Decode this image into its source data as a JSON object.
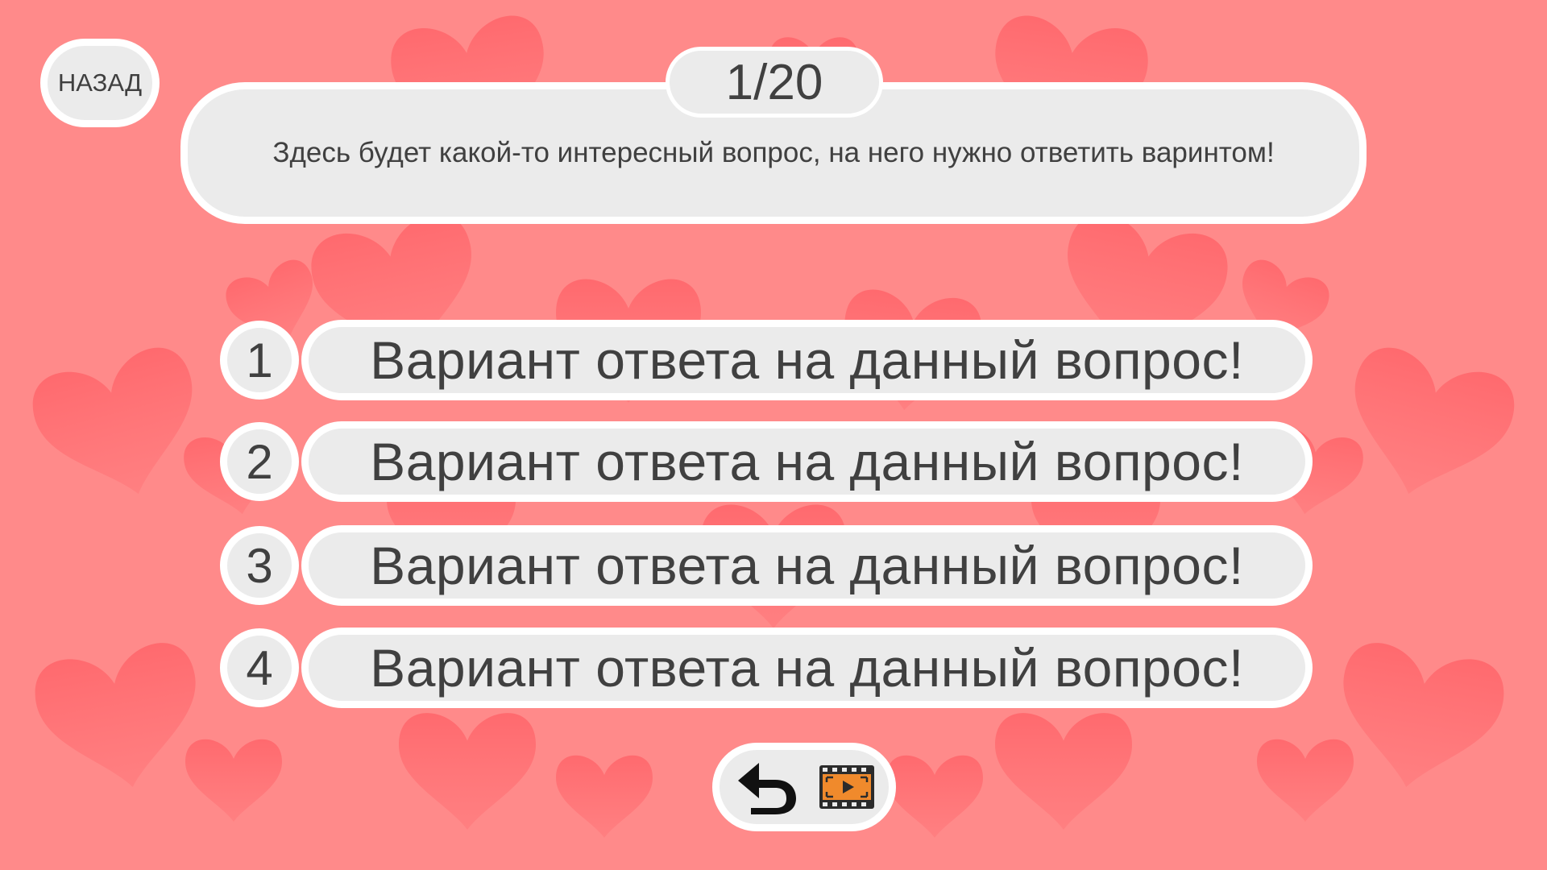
{
  "nav": {
    "back_label": "НАЗАД"
  },
  "progress": {
    "counter": "1/20",
    "current": 1,
    "total": 20
  },
  "question": {
    "text": "Здесь будет какой-то интересный вопрос, на него нужно ответить варинтом!"
  },
  "answers": [
    {
      "number": "1",
      "text": "Вариант ответа на данный вопрос!"
    },
    {
      "number": "2",
      "text": "Вариант ответа на данный вопрос!"
    },
    {
      "number": "3",
      "text": "Вариант ответа на данный вопрос!"
    },
    {
      "number": "4",
      "text": "Вариант ответа на данный вопрос!"
    }
  ],
  "bottom_bar": {
    "icons": [
      "undo-arrow-icon",
      "video-film-icon"
    ]
  },
  "theme": {
    "background": "#ff8a8a",
    "heart": "#ff6b6e",
    "panel": "#ebebeb",
    "border": "#ffffff",
    "text": "#404040",
    "video_icon_orange": "#f08a2c"
  }
}
